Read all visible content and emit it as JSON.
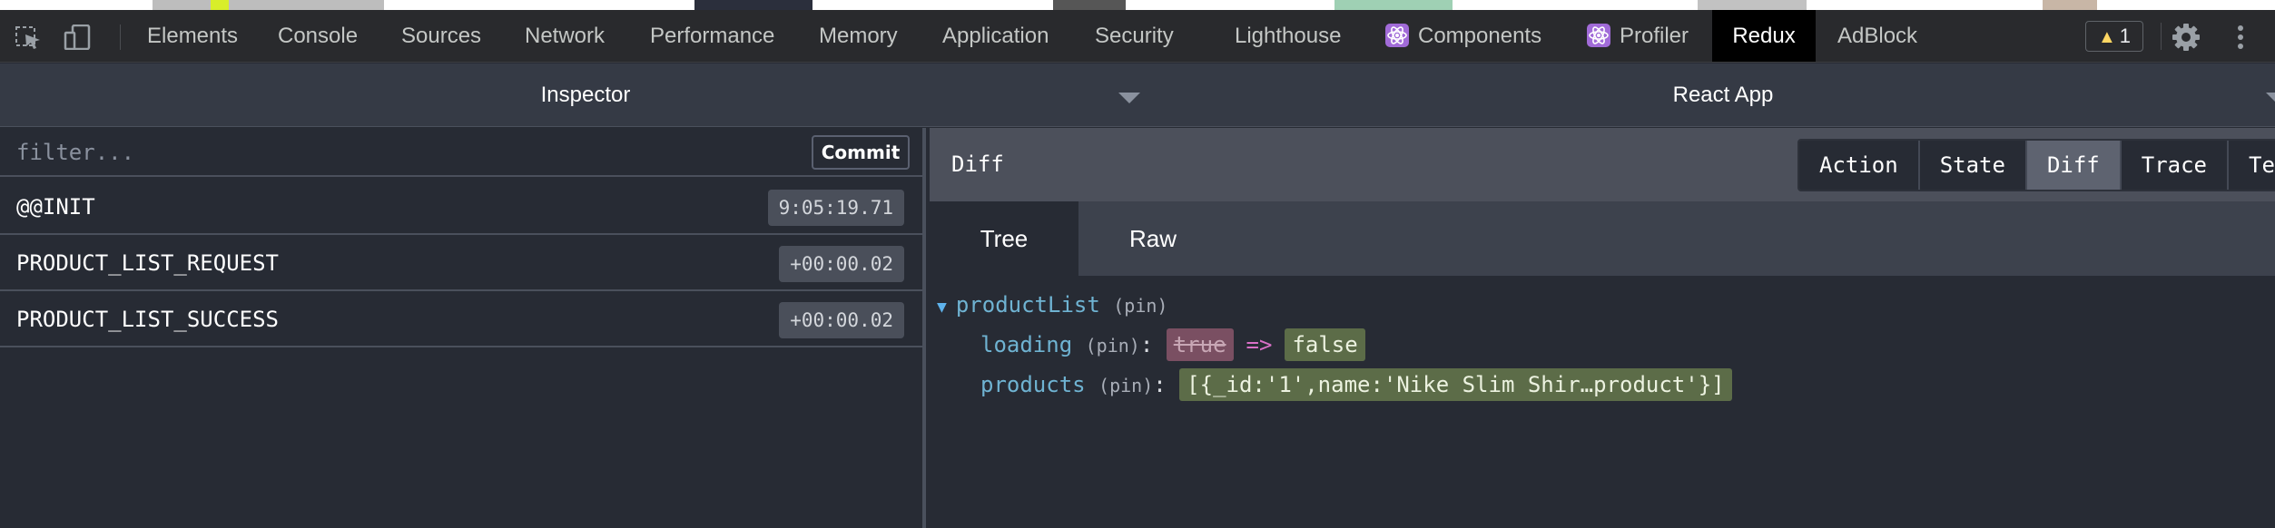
{
  "devtools": {
    "tabs": [
      "Elements",
      "Console",
      "Sources",
      "Network",
      "Performance",
      "Memory",
      "Application",
      "Security",
      "Lighthouse",
      "Components",
      "Profiler",
      "Redux",
      "AdBlock"
    ],
    "active_tab": "Redux",
    "warning_count": "1"
  },
  "header": {
    "inspector_title": "Inspector",
    "app_title": "React App"
  },
  "left": {
    "filter_placeholder": "filter...",
    "commit_label": "Commit",
    "actions": [
      {
        "name": "@@INIT",
        "time": "9:05:19.71"
      },
      {
        "name": "PRODUCT_LIST_REQUEST",
        "time": "+00:00.02"
      },
      {
        "name": "PRODUCT_LIST_SUCCESS",
        "time": "+00:00.02"
      }
    ]
  },
  "right": {
    "panel_title": "Diff",
    "mode_tabs": [
      "Action",
      "State",
      "Diff",
      "Trace",
      "Test"
    ],
    "active_mode": "Diff",
    "view_tabs": [
      "Tree",
      "Raw"
    ],
    "active_view": "Tree",
    "tree": {
      "root_key": "productList",
      "pin": "(pin)",
      "colon": ":",
      "arrow": "=>",
      "loading_key": "loading",
      "loading_old": "true",
      "loading_new": "false",
      "products_key": "products",
      "products_new": "[{_id:'1',name:'Nike Slim Shir…product'}]"
    }
  },
  "colors": {
    "panel_bg": "#272b34",
    "tabbar_bg": "#292a2d",
    "header_bg": "#353a45",
    "diff_header_bg": "#4c505b",
    "removed_bg": "#7a4f62",
    "added_bg": "#5c6c48",
    "key_color": "#6fb3d2",
    "arrow_color": "#d870c6",
    "react_icon": "#a16bd8",
    "warning": "#fdd663"
  },
  "icons": [
    "inspect-element-icon",
    "device-toolbar-icon",
    "react-components-icon",
    "react-profiler-icon",
    "warning-icon",
    "settings-gear-icon",
    "more-options-icon",
    "dropdown-caret-icon",
    "expand-caret-icon"
  ]
}
